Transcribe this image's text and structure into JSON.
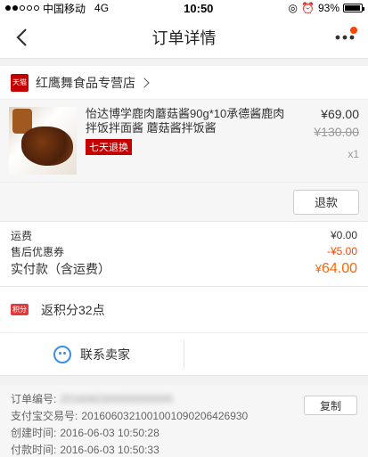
{
  "status_bar": {
    "carrier": "中国移动",
    "network": "4G",
    "time": "10:50",
    "battery": "93%",
    "battery_level": 0.93
  },
  "nav": {
    "title": "订单详情",
    "back_icon": "chevron-left-icon",
    "more_icon": "more-icon",
    "more_badge_color": "#ff4400"
  },
  "shop": {
    "logo": "天猫",
    "name": "红鹰舞食品专营店"
  },
  "product": {
    "title": "怡达博学鹿肉蘑菇酱90g*10承德酱鹿肉拌饭拌面酱 蘑菇酱拌饭酱",
    "tag": "七天退换",
    "price_now": "¥69.00",
    "price_old": "¥130.00",
    "quantity": "x1",
    "refund_button": "退款"
  },
  "summary": {
    "shipping_label": "运费",
    "shipping_value": "¥0.00",
    "coupon_label": "售后优惠券",
    "coupon_value": "-¥5.00",
    "total_label": "实付款（含运费）",
    "total_currency": "¥",
    "total_value": "64.00",
    "accent_color": "#ff6600"
  },
  "points": {
    "icon_text": "积分",
    "text": "返积分32点"
  },
  "contact": {
    "label": "联系卖家"
  },
  "order_info": {
    "order_no_label": "订单编号:",
    "order_no_value": "2016060300000000000",
    "alipay_label": "支付宝交易号:",
    "alipay_value": "2016060321001001090206426930",
    "created_label": "创建时间:",
    "created_value": "2016-06-03 10:50:28",
    "paid_label": "付款时间:",
    "paid_value": "2016-06-03 10:50:33",
    "copy_button": "复制"
  }
}
